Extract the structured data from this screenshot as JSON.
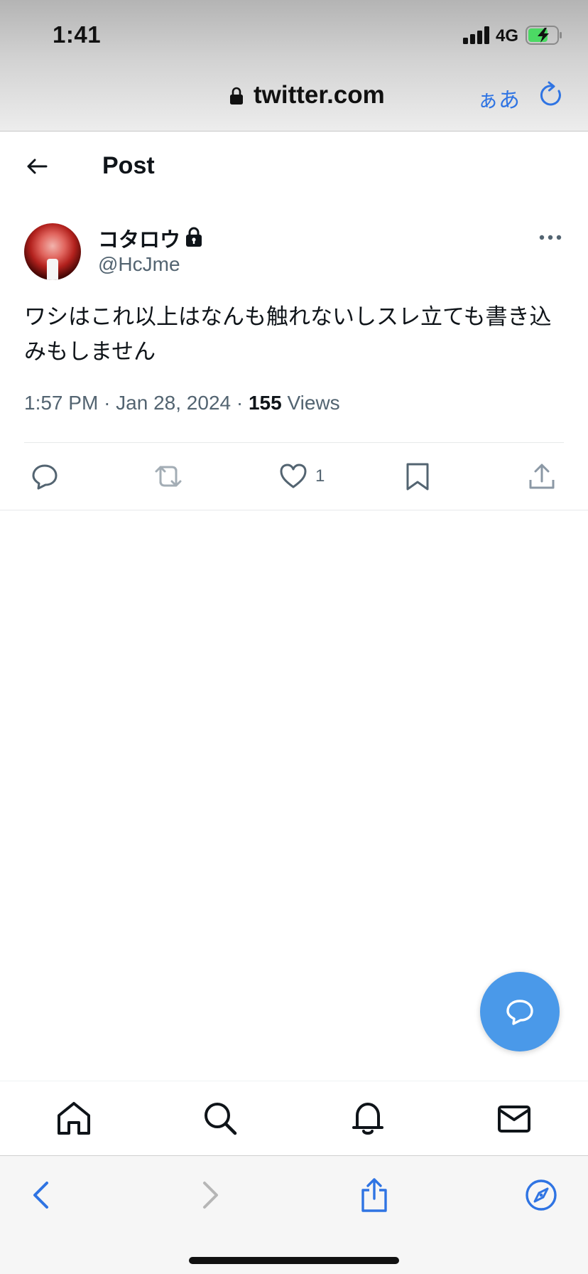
{
  "status_bar": {
    "time": "1:41",
    "network": "4G"
  },
  "browser": {
    "url": "twitter.com",
    "aa_label": "ぁあ"
  },
  "header": {
    "title": "Post"
  },
  "author": {
    "display_name": "コタロウ",
    "handle": "@HcJme"
  },
  "tweet": {
    "text": "ワシはこれ以上はなんも触れないしスレ立ても書き込みもしません",
    "time": "1:57 PM",
    "date": "Jan 28, 2024",
    "views_count": "155",
    "views_label": "Views",
    "like_count": "1"
  },
  "icons": {
    "back": "arrow-left-icon",
    "protected": "lock-icon",
    "more": "ellipsis-icon",
    "reply": "reply-icon",
    "retweet": "retweet-icon",
    "like": "heart-icon",
    "bookmark": "bookmark-icon",
    "share": "share-icon",
    "compose": "compose-reply-icon",
    "home": "home-icon",
    "search": "search-icon",
    "notifications": "bell-icon",
    "messages": "mail-icon"
  },
  "colors": {
    "accent": "#1d9bf0",
    "fab": "#4a99e9",
    "safari_blue": "#2f74e3",
    "secondary_text": "#536471",
    "battery_green": "#4cd964"
  }
}
